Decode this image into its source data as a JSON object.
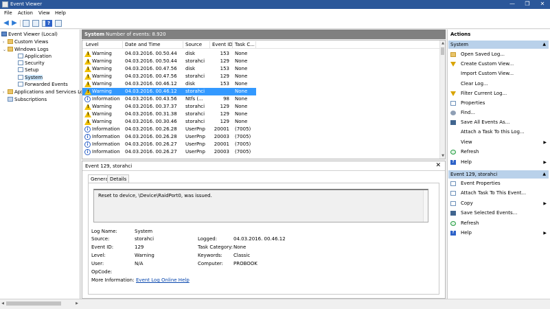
{
  "window": {
    "title": "Event Viewer",
    "minimize": "—",
    "maximize": "❐",
    "close": "✕"
  },
  "menu": [
    "File",
    "Action",
    "View",
    "Help"
  ],
  "tree": {
    "root": "Event Viewer (Local)",
    "custom_views": "Custom Views",
    "windows_logs": "Windows Logs",
    "application": "Application",
    "security": "Security",
    "setup": "Setup",
    "system": "System",
    "forwarded": "Forwarded Events",
    "apps_services": "Applications and Services Lo",
    "subscriptions": "Subscriptions"
  },
  "center": {
    "title": "System",
    "count": "Number of events: 8.920"
  },
  "columns": [
    "Level",
    "Date and Time",
    "Source",
    "Event ID",
    "Task C..."
  ],
  "events": [
    {
      "level": "Warning",
      "date": "04.03.2016. 00.50.44",
      "source": "disk",
      "id": "153",
      "task": "None"
    },
    {
      "level": "Warning",
      "date": "04.03.2016. 00.50.44",
      "source": "storahci",
      "id": "129",
      "task": "None"
    },
    {
      "level": "Warning",
      "date": "04.03.2016. 00.47.56",
      "source": "disk",
      "id": "153",
      "task": "None"
    },
    {
      "level": "Warning",
      "date": "04.03.2016. 00.47.56",
      "source": "storahci",
      "id": "129",
      "task": "None"
    },
    {
      "level": "Warning",
      "date": "04.03.2016. 00.46.12",
      "source": "disk",
      "id": "153",
      "task": "None"
    },
    {
      "level": "Warning",
      "date": "04.03.2016. 00.46.12",
      "source": "storahci",
      "id": "129",
      "task": "None"
    },
    {
      "level": "Information",
      "date": "04.03.2016. 00.43.56",
      "source": "Ntfs (...",
      "id": "98",
      "task": "None"
    },
    {
      "level": "Warning",
      "date": "04.03.2016. 00.37.37",
      "source": "storahci",
      "id": "129",
      "task": "None"
    },
    {
      "level": "Warning",
      "date": "04.03.2016. 00.31.38",
      "source": "storahci",
      "id": "129",
      "task": "None"
    },
    {
      "level": "Warning",
      "date": "04.03.2016. 00.30.46",
      "source": "storahci",
      "id": "129",
      "task": "None"
    },
    {
      "level": "Information",
      "date": "04.03.2016. 00.26.28",
      "source": "UserPnp",
      "id": "20001",
      "task": "(7005)"
    },
    {
      "level": "Information",
      "date": "04.03.2016. 00.26.28",
      "source": "UserPnp",
      "id": "20003",
      "task": "(7005)"
    },
    {
      "level": "Information",
      "date": "04.03.2016. 00.26.27",
      "source": "UserPnp",
      "id": "20001",
      "task": "(7005)"
    },
    {
      "level": "Information",
      "date": "04.03.2016. 00.26.27",
      "source": "UserPnp",
      "id": "20003",
      "task": "(7005)"
    }
  ],
  "detail": {
    "title": "Event 129, storahci",
    "close": "✕",
    "tabs": [
      "General",
      "Details"
    ],
    "message": "Reset to device, \\Device\\RaidPort0, was issued.",
    "log_name_label": "Log Name:",
    "log_name": "System",
    "source_label": "Source:",
    "source": "storahci",
    "logged_label": "Logged:",
    "logged": "04.03.2016. 00.46.12",
    "event_id_label": "Event ID:",
    "event_id": "129",
    "task_category_label": "Task Category:",
    "task_category": "None",
    "level_label": "Level:",
    "level": "Warning",
    "keywords_label": "Keywords:",
    "keywords": "Classic",
    "user_label": "User:",
    "user": "N/A",
    "computer_label": "Computer:",
    "computer": "PROBOOK",
    "opcode_label": "OpCode:",
    "more_info_label": "More Information:",
    "more_info_link": "Event Log Online Help"
  },
  "actions": {
    "title": "Actions",
    "section1": "System",
    "section1_items": [
      "Open Saved Log...",
      "Create Custom View...",
      "Import Custom View...",
      "Clear Log...",
      "Filter Current Log...",
      "Properties",
      "Find...",
      "Save All Events As...",
      "Attach a Task To this Log...",
      "View",
      "Refresh",
      "Help"
    ],
    "section2": "Event 129, storahci",
    "section2_items": [
      "Event Properties",
      "Attach Task To This Event...",
      "Copy",
      "Save Selected Events...",
      "Refresh",
      "Help"
    ]
  }
}
